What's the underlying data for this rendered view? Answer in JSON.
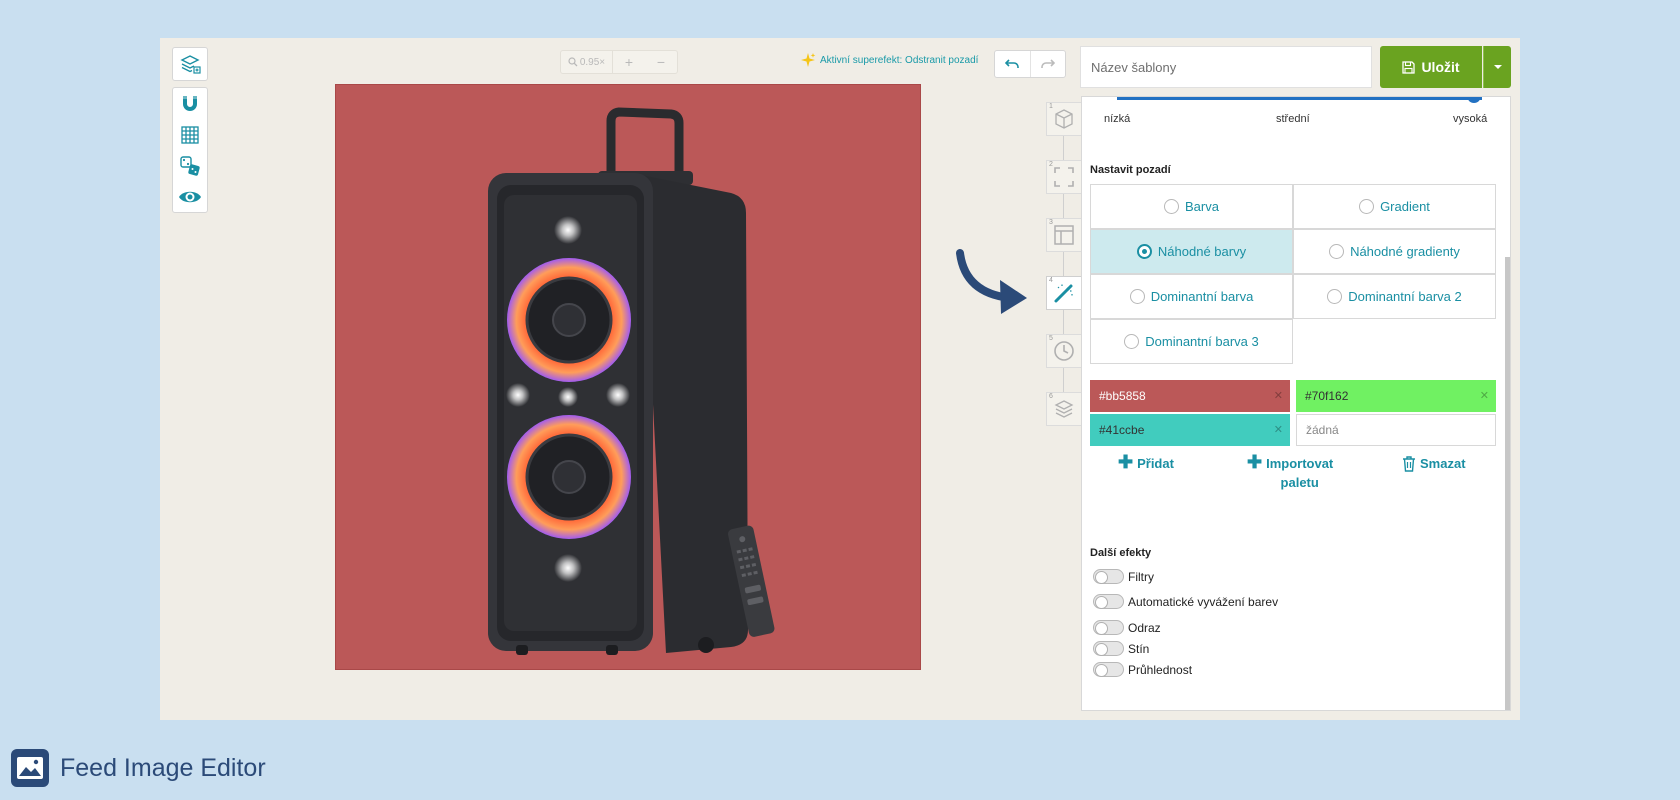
{
  "zoom": {
    "value": "0.95×",
    "plus": "+",
    "minus": "−"
  },
  "superefekt": "Aktivní superefekt: Odstranit pozadí",
  "template_name": {
    "value": "",
    "placeholder": "Název šablony"
  },
  "save": {
    "label": "Uložit"
  },
  "panel": {
    "slider": {
      "labels": [
        "nízká",
        "střední",
        "vysoká"
      ],
      "value": "vysoká"
    },
    "background_title": "Nastavit pozadí",
    "background_options": [
      {
        "label": "Barva",
        "selected": false
      },
      {
        "label": "Gradient",
        "selected": false
      },
      {
        "label": "Náhodné barvy",
        "selected": true
      },
      {
        "label": "Náhodné gradienty",
        "selected": false
      },
      {
        "label": "Dominantní barva",
        "selected": false
      },
      {
        "label": "Dominantní barva 2",
        "selected": false
      },
      {
        "label": "Dominantní barva 3",
        "selected": false
      }
    ],
    "swatches": [
      {
        "label": "#bb5858",
        "color": "#bb5858"
      },
      {
        "label": "#70f162",
        "color": "#70f162"
      },
      {
        "label": "#41ccbe",
        "color": "#41ccbe"
      },
      {
        "label": "žádná",
        "color": ""
      }
    ],
    "actions": {
      "add": "Přidat",
      "import_line1": "Importovat",
      "import_line2": "paletu",
      "delete": "Smazat"
    },
    "effects_title": "Další efekty",
    "effects": [
      "Filtry",
      "Automatické vyvážení barev",
      "Odraz",
      "Stín",
      "Průhlednost"
    ]
  },
  "steps": [
    "1",
    "2",
    "3",
    "4",
    "5",
    "6"
  ],
  "canvas_color": "#bb5858",
  "brand": {
    "name": "Feed Image Editor"
  },
  "colors": {
    "accent": "#1a8fa3",
    "save": "#6aa320",
    "brand": "#2b4a78"
  }
}
